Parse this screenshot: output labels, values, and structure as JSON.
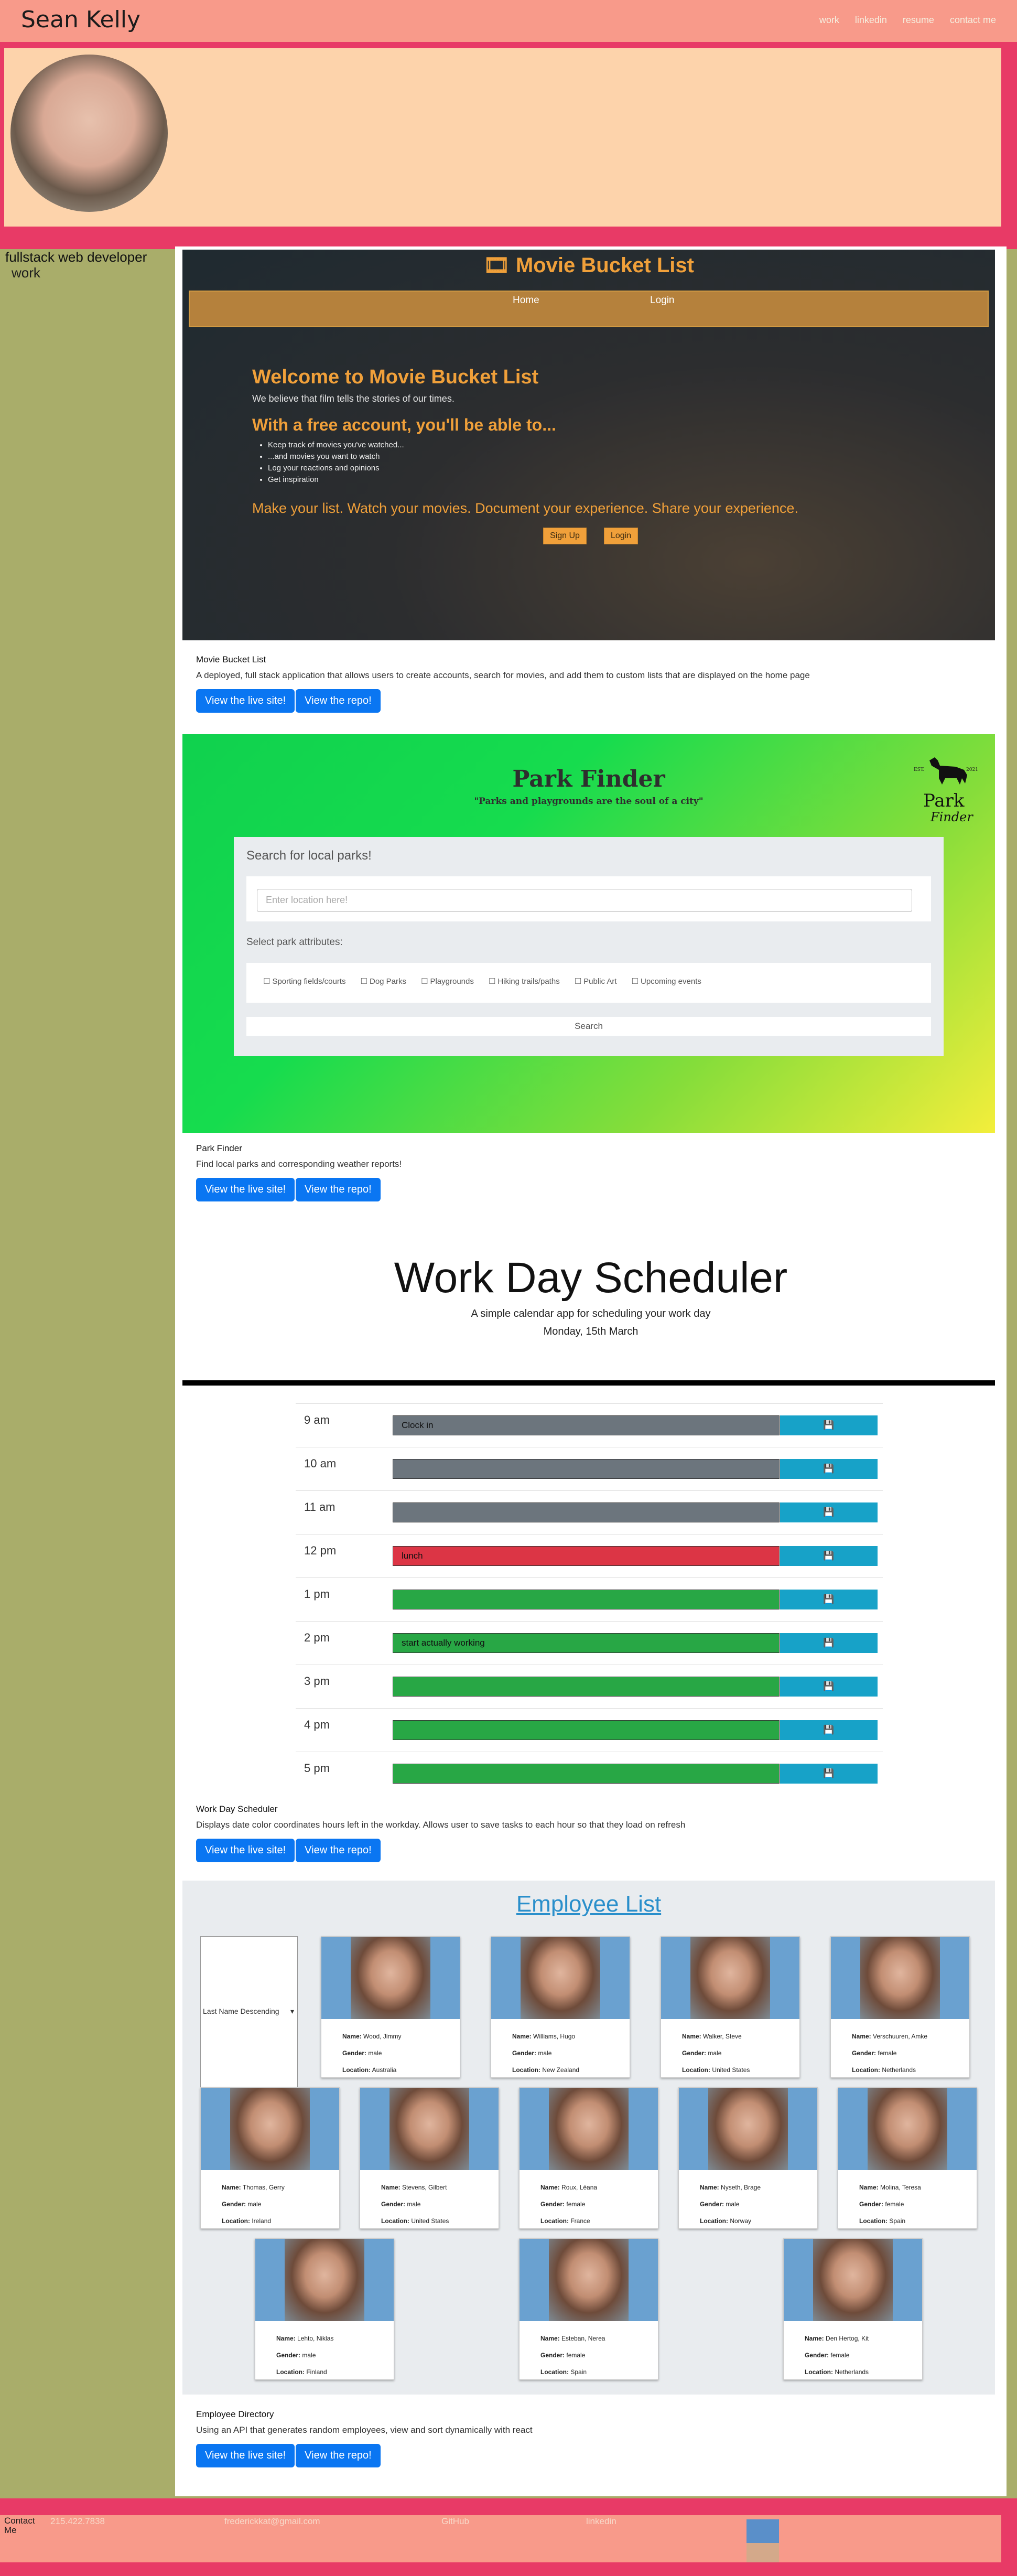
{
  "nav": {
    "brand": "Sean Kelly",
    "links": [
      "work",
      "linkedin",
      "resume",
      "contact me"
    ]
  },
  "hero": {
    "subtitle": "fullstack web developer"
  },
  "aside": {
    "label": "work"
  },
  "projects": {
    "movie": {
      "screenshot": {
        "title": "Movie Bucket List",
        "nav": [
          "Home",
          "Login"
        ],
        "welcome": "Welcome to Movie Bucket List",
        "tagline": "We believe that film tells the stories of our times.",
        "free": "With a free account, you'll be able to...",
        "features": [
          "Keep track of movies you've watched...",
          "...and movies you want to watch",
          "Log your reactions and opinions",
          "Get inspiration"
        ],
        "cta": "Make your list. Watch your movies. Document your experience. Share your experience.",
        "signup": "Sign Up",
        "login": "Login"
      },
      "title": "Movie Bucket List",
      "description": "A deployed, full stack application that allows users to create accounts, search for movies, and add them to custom lists that are displayed on the home page",
      "live": "View the live site!",
      "repo": "View the repo!"
    },
    "park": {
      "screenshot": {
        "title": "Park Finder",
        "quote": "\"Parks and playgrounds are the soul of a city\"",
        "logo_est": "EST.",
        "logo_year": "2021",
        "logo_word1": "Park",
        "logo_word2": "Finder",
        "search_heading": "Search for local parks!",
        "placeholder": "Enter location here!",
        "attributes_label": "Select park attributes:",
        "attributes": [
          "Sporting fields/courts",
          "Dog Parks",
          "Playgrounds",
          "Hiking trails/paths",
          "Public Art",
          "Upcoming events"
        ],
        "search": "Search"
      },
      "title": "Park Finder",
      "description": "Find local parks and corresponding weather reports!",
      "live": "View the live site!",
      "repo": "View the repo!"
    },
    "scheduler": {
      "screenshot": {
        "title": "Work Day Scheduler",
        "subtitle": "A simple calendar app for scheduling your work day",
        "date": "Monday, 15th March",
        "hours": [
          {
            "time": "9 am",
            "text": "Clock in",
            "state": "past"
          },
          {
            "time": "10 am",
            "text": "",
            "state": "past"
          },
          {
            "time": "11 am",
            "text": "",
            "state": "past"
          },
          {
            "time": "12 pm",
            "text": "lunch",
            "state": "present"
          },
          {
            "time": "1 pm",
            "text": "",
            "state": "future"
          },
          {
            "time": "2 pm",
            "text": "start actually working",
            "state": "future"
          },
          {
            "time": "3 pm",
            "text": "",
            "state": "future"
          },
          {
            "time": "4 pm",
            "text": "",
            "state": "future"
          },
          {
            "time": "5 pm",
            "text": "",
            "state": "future"
          }
        ],
        "save_icon": "save-icon"
      },
      "title": "Work Day Scheduler",
      "description": "Displays date color coordinates hours left in the workday. Allows user to save tasks to each hour so that they load on refresh",
      "live": "View the live site!",
      "repo": "View the repo!"
    },
    "employees": {
      "screenshot": {
        "title": "Employee List",
        "sort": "Last Name Descending",
        "labels": {
          "name": "Name:",
          "gender": "Gender:",
          "location": "Location:"
        },
        "people": [
          {
            "name": "Wood, Jimmy",
            "gender": "male",
            "location": "Australia"
          },
          {
            "name": "Williams, Hugo",
            "gender": "male",
            "location": "New Zealand"
          },
          {
            "name": "Walker, Steve",
            "gender": "male",
            "location": "United States"
          },
          {
            "name": "Verschuuren, Amke",
            "gender": "female",
            "location": "Netherlands"
          },
          {
            "name": "Thomas, Gerry",
            "gender": "male",
            "location": "Ireland"
          },
          {
            "name": "Stevens, Gilbert",
            "gender": "male",
            "location": "United States"
          },
          {
            "name": "Roux, Léana",
            "gender": "female",
            "location": "France"
          },
          {
            "name": "Nyseth, Brage",
            "gender": "male",
            "location": "Norway"
          },
          {
            "name": "Molina, Teresa",
            "gender": "female",
            "location": "Spain"
          },
          {
            "name": "Lehto, Niklas",
            "gender": "male",
            "location": "Finland"
          },
          {
            "name": "Esteban, Nerea",
            "gender": "female",
            "location": "Spain"
          },
          {
            "name": "Den Hertog, Kit",
            "gender": "female",
            "location": "Netherlands"
          }
        ]
      },
      "title": "Employee Directory",
      "description": "Using an API that generates random employees, view and sort dynamically with react",
      "live": "View the live site!",
      "repo": "View the repo!"
    }
  },
  "footer": {
    "label": "Contact Me",
    "phone": "215.422.7838",
    "email": "frederickkat@gmail.com",
    "github": "GitHub",
    "linkedin": "linkedin"
  },
  "colors": {
    "nav": "#f89a8a",
    "hero": "#e83a66",
    "hero_inner": "#fdd3ab",
    "aside": "#a9ad6a",
    "button": "#0a76f2"
  }
}
